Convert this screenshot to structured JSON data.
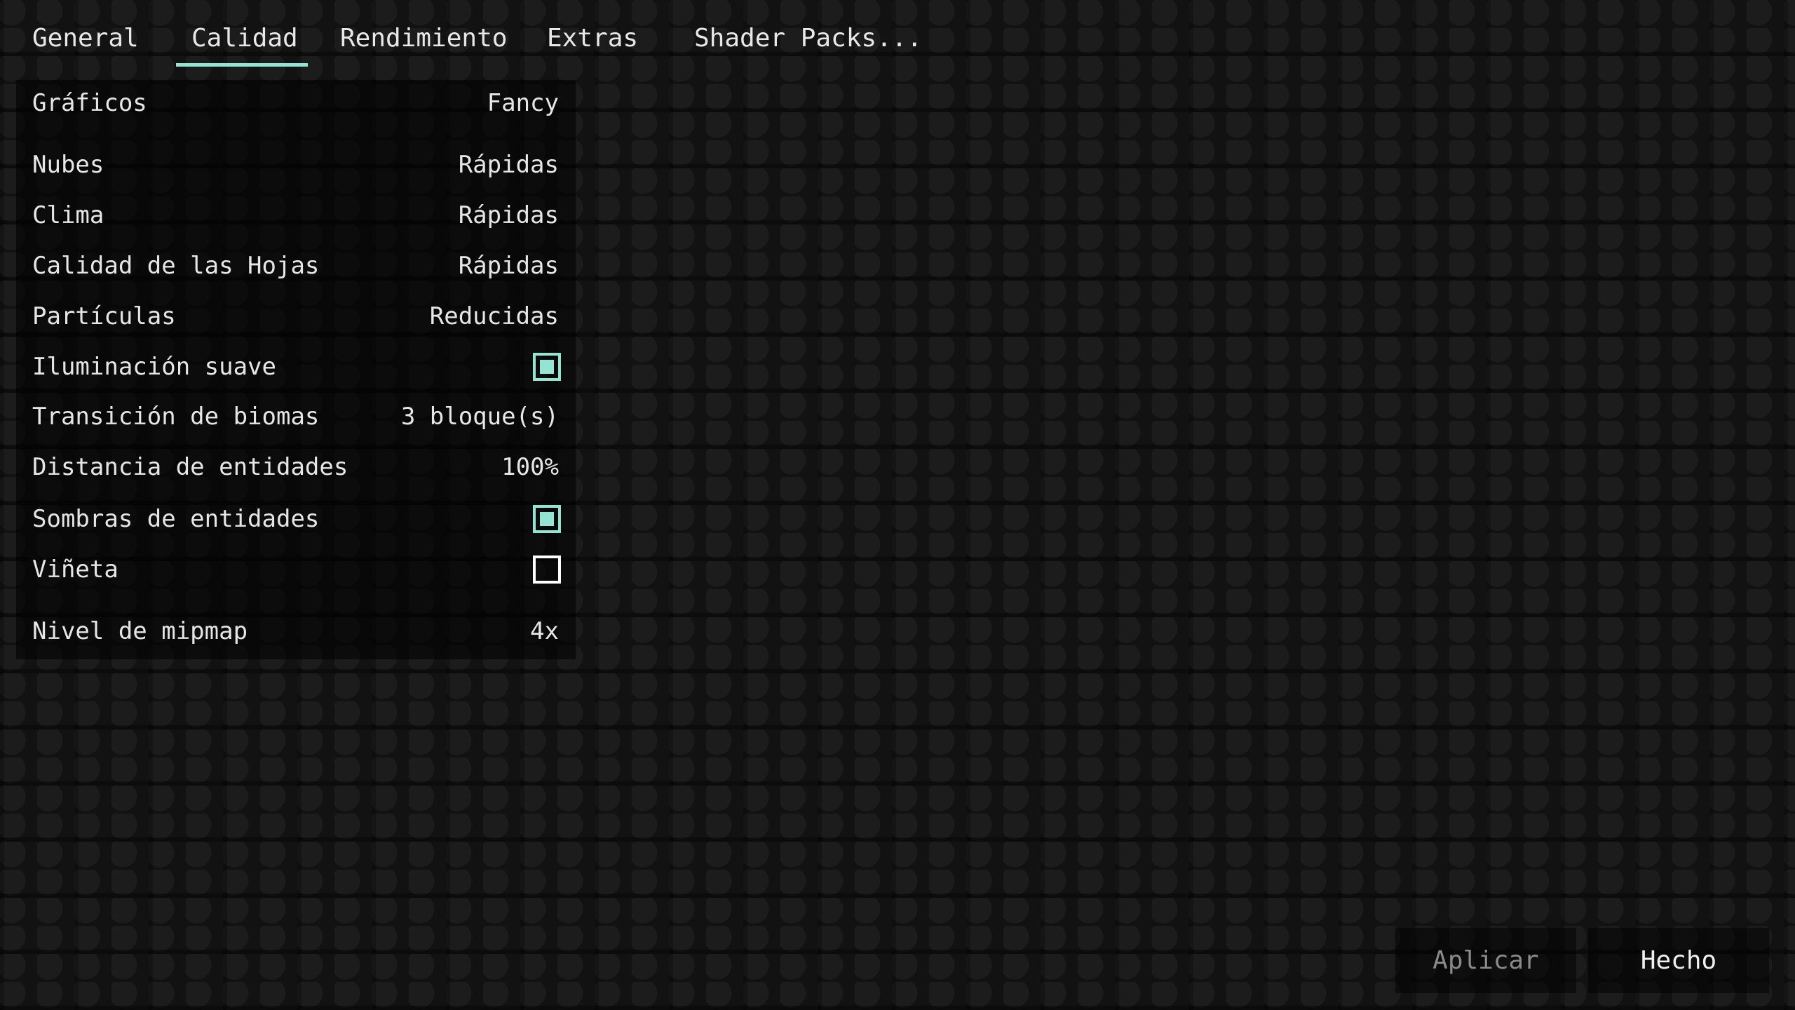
{
  "tabs": [
    {
      "label": "General"
    },
    {
      "label": "Calidad",
      "active": true
    },
    {
      "label": "Rendimiento"
    },
    {
      "label": "Extras"
    },
    {
      "label": "Shader Packs..."
    }
  ],
  "settings": [
    {
      "label": "Gráficos",
      "value": "Fancy"
    },
    {
      "label": "Nubes",
      "value": "Rápidas"
    },
    {
      "label": "Clima",
      "value": "Rápidas"
    },
    {
      "label": "Calidad de las Hojas",
      "value": "Rápidas"
    },
    {
      "label": "Partículas",
      "value": "Reducidas"
    },
    {
      "label": "Iluminación suave",
      "checked": true
    },
    {
      "label": "Transición de biomas",
      "value": "3 bloque(s)"
    },
    {
      "label": "Distancia de entidades",
      "value": "100%"
    },
    {
      "label": "Sombras de entidades",
      "checked": true
    },
    {
      "label": "Viñeta",
      "checked": false
    },
    {
      "label": "Nivel de mipmap",
      "value": "4x"
    }
  ],
  "buttons": {
    "apply": "Aplicar",
    "done": "Hecho"
  },
  "colors": {
    "accent": "#94e4d3",
    "disabled_text": "#8a8a8a"
  }
}
